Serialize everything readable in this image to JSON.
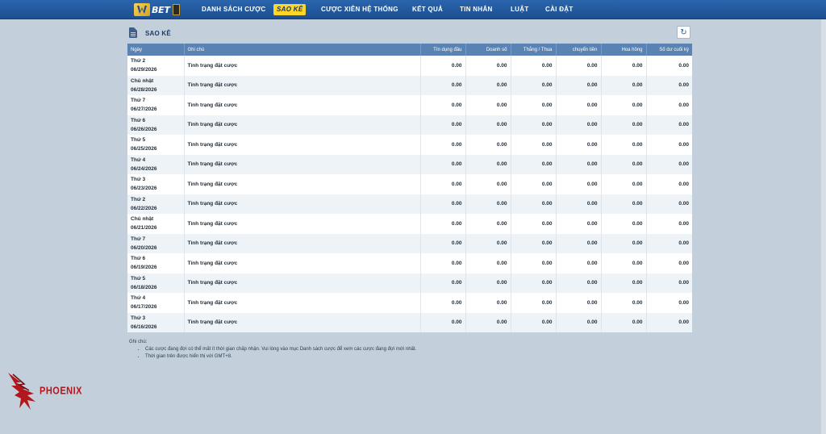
{
  "brand": {
    "logo_text": "BET"
  },
  "nav": {
    "items": [
      {
        "label": "DANH SÁCH CƯỢC",
        "active": false
      },
      {
        "label": "SAO KÊ",
        "active": true
      },
      {
        "label": "CƯỢC XIÊN HỆ THỐNG",
        "active": false
      },
      {
        "label": "KẾT QUẢ",
        "active": false
      },
      {
        "label": "TIN NHẮN",
        "active": false
      },
      {
        "label": "LUẬT",
        "active": false
      },
      {
        "label": "CÀI ĐẶT",
        "active": false
      }
    ]
  },
  "panel": {
    "title": "SAO KÊ",
    "refresh_icon": "refresh-icon",
    "doc_icon": "document-icon"
  },
  "table": {
    "headers": [
      "Ngày",
      "Ghi chú",
      "Tín dụng đầu",
      "Doanh số",
      "Thắng / Thua",
      "chuyển tiền",
      "Hoa hồng",
      "Số dư cuối kỳ"
    ],
    "rows": [
      {
        "day": "Thứ 2",
        "date": "06/29/2026",
        "note": "Tình trạng đặt cược",
        "values": [
          "0.00",
          "0.00",
          "0.00",
          "0.00",
          "0.00",
          "0.00"
        ]
      },
      {
        "day": "Chủ nhật",
        "date": "06/28/2026",
        "note": "Tình trạng đặt cược",
        "values": [
          "0.00",
          "0.00",
          "0.00",
          "0.00",
          "0.00",
          "0.00"
        ]
      },
      {
        "day": "Thứ 7",
        "date": "06/27/2026",
        "note": "Tình trạng đặt cược",
        "values": [
          "0.00",
          "0.00",
          "0.00",
          "0.00",
          "0.00",
          "0.00"
        ]
      },
      {
        "day": "Thứ 6",
        "date": "06/26/2026",
        "note": "Tình trạng đặt cược",
        "values": [
          "0.00",
          "0.00",
          "0.00",
          "0.00",
          "0.00",
          "0.00"
        ]
      },
      {
        "day": "Thứ 5",
        "date": "06/25/2026",
        "note": "Tình trạng đặt cược",
        "values": [
          "0.00",
          "0.00",
          "0.00",
          "0.00",
          "0.00",
          "0.00"
        ]
      },
      {
        "day": "Thứ 4",
        "date": "06/24/2026",
        "note": "Tình trạng đặt cược",
        "values": [
          "0.00",
          "0.00",
          "0.00",
          "0.00",
          "0.00",
          "0.00"
        ]
      },
      {
        "day": "Thứ 3",
        "date": "06/23/2026",
        "note": "Tình trạng đặt cược",
        "values": [
          "0.00",
          "0.00",
          "0.00",
          "0.00",
          "0.00",
          "0.00"
        ]
      },
      {
        "day": "Thứ 2",
        "date": "06/22/2026",
        "note": "Tình trạng đặt cược",
        "values": [
          "0.00",
          "0.00",
          "0.00",
          "0.00",
          "0.00",
          "0.00"
        ]
      },
      {
        "day": "Chủ nhật",
        "date": "06/21/2026",
        "note": "Tình trạng đặt cược",
        "values": [
          "0.00",
          "0.00",
          "0.00",
          "0.00",
          "0.00",
          "0.00"
        ]
      },
      {
        "day": "Thứ 7",
        "date": "06/20/2026",
        "note": "Tình trạng đặt cược",
        "values": [
          "0.00",
          "0.00",
          "0.00",
          "0.00",
          "0.00",
          "0.00"
        ]
      },
      {
        "day": "Thứ 6",
        "date": "06/19/2026",
        "note": "Tình trạng đặt cược",
        "values": [
          "0.00",
          "0.00",
          "0.00",
          "0.00",
          "0.00",
          "0.00"
        ]
      },
      {
        "day": "Thứ 5",
        "date": "06/18/2026",
        "note": "Tình trạng đặt cược",
        "values": [
          "0.00",
          "0.00",
          "0.00",
          "0.00",
          "0.00",
          "0.00"
        ]
      },
      {
        "day": "Thứ 4",
        "date": "06/17/2026",
        "note": "Tình trạng đặt cược",
        "values": [
          "0.00",
          "0.00",
          "0.00",
          "0.00",
          "0.00",
          "0.00"
        ]
      },
      {
        "day": "Thứ 3",
        "date": "06/16/2026",
        "note": "Tình trạng đặt cược",
        "values": [
          "0.00",
          "0.00",
          "0.00",
          "0.00",
          "0.00",
          "0.00"
        ]
      }
    ]
  },
  "notes": {
    "title": "Ghi chú:",
    "items": [
      "Các cược đang đợi có thể mất ít thời gian chấp nhận. Vui lòng vào mục Danh sách cược để xem các cược đang đợi mới nhất.",
      "Thời gian trên được hiển thị với GMT+8."
    ]
  },
  "watermark": {
    "text": "PHOENIX"
  },
  "colors": {
    "nav_bg": "#1f56a0",
    "active_tab": "#ffd52a",
    "table_header": "#5a83b3",
    "page_bg": "#c3d0dc",
    "watermark": "#b3161b"
  }
}
